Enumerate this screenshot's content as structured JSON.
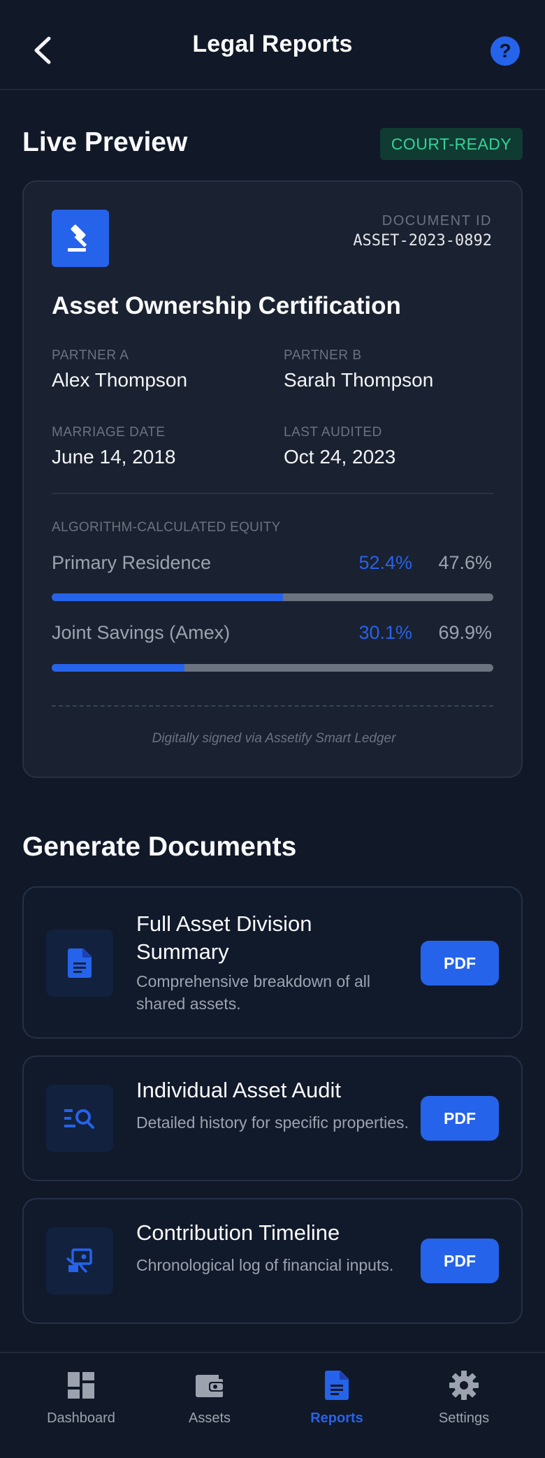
{
  "header": {
    "title": "Legal Reports",
    "help_glyph": "?"
  },
  "preview": {
    "section_title": "Live Preview",
    "badge": "COURT-READY",
    "doc_id_label": "DOCUMENT ID",
    "doc_id": "ASSET-2023-0892",
    "cert_title": "Asset Ownership Certification",
    "fields": [
      {
        "label": "PARTNER A",
        "value": "Alex Thompson"
      },
      {
        "label": "PARTNER B",
        "value": "Sarah Thompson"
      },
      {
        "label": "MARRIAGE DATE",
        "value": "June 14, 2018"
      },
      {
        "label": "LAST AUDITED",
        "value": "Oct 24, 2023"
      }
    ],
    "equity_label": "ALGORITHM-CALCULATED EQUITY",
    "equity": [
      {
        "name": "Primary Residence",
        "a_text": "52.4%",
        "b_text": "47.6%",
        "a_share": 0.524
      },
      {
        "name": "Joint Savings (Amex)",
        "a_text": "30.1%",
        "b_text": "69.9%",
        "a_share": 0.301
      }
    ],
    "signed_note": "Digitally signed via Assetify Smart Ledger"
  },
  "generate": {
    "section_title": "Generate Documents",
    "cards": [
      {
        "title": "Full Asset Division Summary",
        "desc": "Comprehensive breakdown of all shared assets.",
        "button": "PDF",
        "icon": "file-document-icon"
      },
      {
        "title": "Individual Asset Audit",
        "desc": "Detailed history for specific properties.",
        "button": "PDF",
        "icon": "list-search-icon"
      },
      {
        "title": "Contribution Timeline",
        "desc": "Chronological log of financial inputs.",
        "button": "PDF",
        "icon": "hand-coin-icon"
      }
    ]
  },
  "nav": {
    "items": [
      {
        "label": "Dashboard",
        "icon": "dashboard-icon"
      },
      {
        "label": "Assets",
        "icon": "wallet-icon"
      },
      {
        "label": "Reports",
        "icon": "report-document-icon",
        "active": true
      },
      {
        "label": "Settings",
        "icon": "gear-icon"
      }
    ]
  },
  "colors": {
    "background": "#111827",
    "accent": "#2563eb",
    "success": "#34d399",
    "muted": "#9ca3af"
  }
}
